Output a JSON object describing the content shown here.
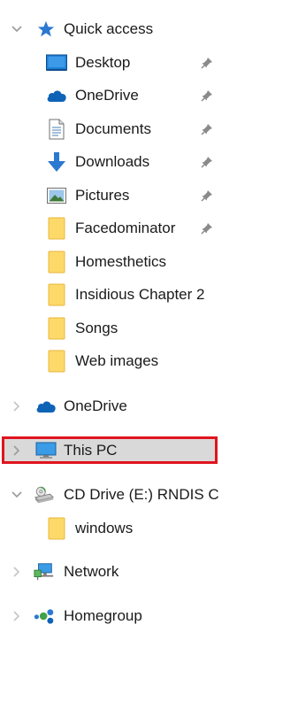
{
  "nav_pane": {
    "quick_access": {
      "label": "Quick access",
      "icon": "star-icon",
      "expanded": true,
      "items": [
        {
          "label": "Desktop",
          "icon": "desktop-icon",
          "pinned": true
        },
        {
          "label": "OneDrive",
          "icon": "cloud-icon",
          "pinned": true
        },
        {
          "label": "Documents",
          "icon": "document-icon",
          "pinned": true
        },
        {
          "label": "Downloads",
          "icon": "download-arrow-icon",
          "pinned": true
        },
        {
          "label": "Pictures",
          "icon": "picture-icon",
          "pinned": true
        },
        {
          "label": "Facedominator",
          "icon": "folder-icon",
          "pinned": true
        },
        {
          "label": "Homesthetics",
          "icon": "folder-icon",
          "pinned": false
        },
        {
          "label": "Insidious Chapter 2",
          "icon": "folder-icon",
          "pinned": false
        },
        {
          "label": "Songs",
          "icon": "folder-icon",
          "pinned": false
        },
        {
          "label": "Web images",
          "icon": "folder-icon",
          "pinned": false
        }
      ]
    },
    "onedrive": {
      "label": "OneDrive",
      "icon": "cloud-icon",
      "expanded": false
    },
    "this_pc": {
      "label": "This PC",
      "icon": "monitor-icon",
      "expanded": false,
      "selected": true
    },
    "cd_drive": {
      "label": "CD Drive (E:) RNDIS C",
      "icon": "cd-drive-icon",
      "expanded": true,
      "items": [
        {
          "label": "windows",
          "icon": "folder-icon"
        }
      ]
    },
    "network": {
      "label": "Network",
      "icon": "network-icon",
      "expanded": false
    },
    "homegroup": {
      "label": "Homegroup",
      "icon": "homegroup-icon",
      "expanded": false
    }
  },
  "colors": {
    "folder_fill": "#fdd96a",
    "folder_stroke": "#e8b73c",
    "onedrive_blue": "#0f63b6",
    "accent_blue": "#2b79d0",
    "selection_bg": "#d9d9d9",
    "highlight_border": "#e0141e",
    "pin_gray": "#8a8a8a",
    "chevron_gray": "#9a9a9a"
  }
}
